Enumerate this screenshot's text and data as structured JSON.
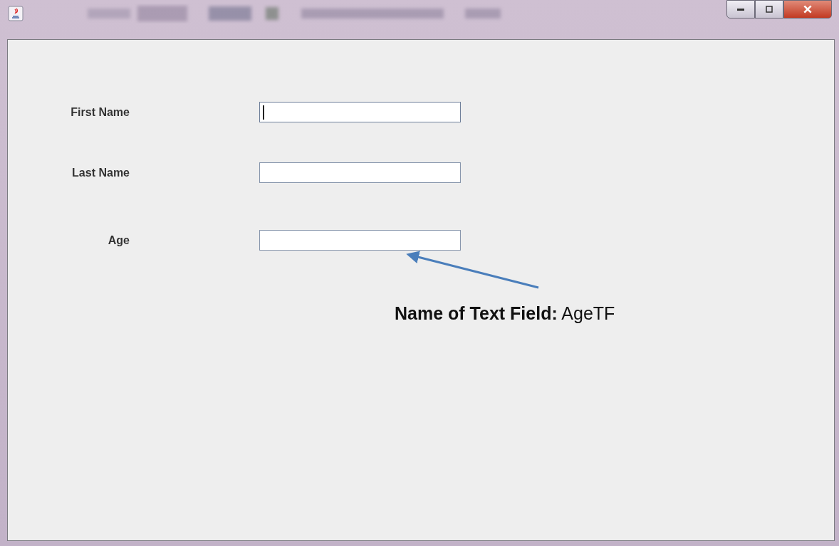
{
  "form": {
    "fields": [
      {
        "label": "First Name",
        "focused": true
      },
      {
        "label": "Last Name",
        "focused": false
      },
      {
        "label": "Age",
        "focused": false
      }
    ]
  },
  "annotation": {
    "text": "**Name of Text Field:** AgeTF"
  }
}
